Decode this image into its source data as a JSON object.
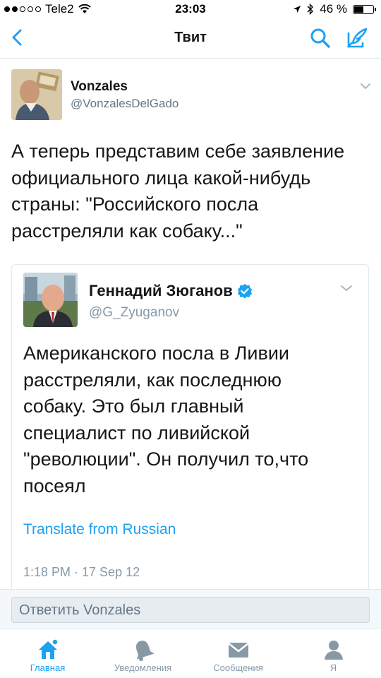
{
  "status_bar": {
    "carrier": "Tele2",
    "time": "23:03",
    "battery_percent_label": "46 %",
    "battery_level": 0.46
  },
  "nav": {
    "title": "Твит",
    "icons": {
      "back": "chevron-left-icon",
      "search": "search-icon",
      "compose": "compose-icon"
    }
  },
  "tweet": {
    "author_name": "Vonzales",
    "author_handle": "@VonzalesDelGado",
    "text": "А теперь представим себе заявление официального лица какой-нибудь страны: \"Российского посла расстреляли как собаку...\""
  },
  "quoted_tweet": {
    "author_name": "Геннадий Зюганов",
    "author_handle": "@G_Zyuganov",
    "verified": true,
    "text": "Американского посла в Ливии расстреляли, как последнюю собаку. Это был главный специалист по ливийской \"революции\". Он получил то,что посеял",
    "translate_label": "Translate from Russian",
    "timestamp": "1:18 PM · 17 Sep 12"
  },
  "reply": {
    "placeholder": "Ответить Vonzales"
  },
  "tabs": [
    {
      "label": "Главная",
      "icon": "home-icon",
      "active": true
    },
    {
      "label": "Уведомления",
      "icon": "bell-icon",
      "active": false
    },
    {
      "label": "Сообщения",
      "icon": "envelope-icon",
      "active": false
    },
    {
      "label": "Я",
      "icon": "profile-icon",
      "active": false
    }
  ],
  "colors": {
    "accent": "#1da1f2",
    "text": "#14171a",
    "secondary": "#657786",
    "border": "#e1e8ed"
  }
}
